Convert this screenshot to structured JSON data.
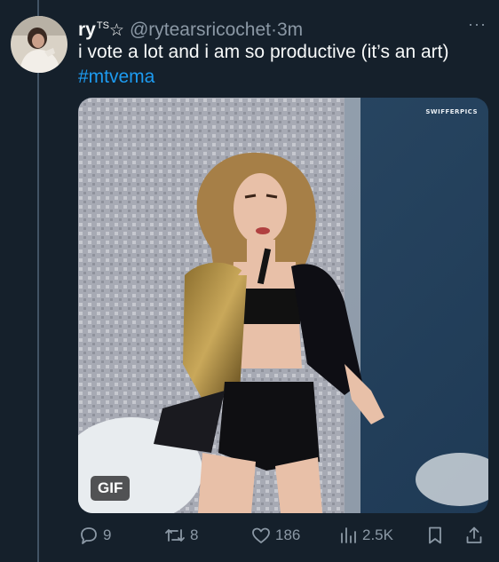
{
  "tweet": {
    "display_name": "ry",
    "name_badge": "TS",
    "name_star": "☆",
    "handle": "@rytearsricochet",
    "separator": "·",
    "time": "3m",
    "text": "i vote a lot and i am so productive (it’s an art)",
    "hashtag": "#mtvema"
  },
  "media": {
    "badge": "GIF",
    "watermark": "SWIFFERPICS"
  },
  "actions": {
    "replies": "9",
    "reposts": "8",
    "likes": "186",
    "views": "2.5K"
  },
  "icons": {
    "more": "more-icon",
    "reply": "reply-icon",
    "repost": "repost-icon",
    "like": "heart-icon",
    "views": "views-icon",
    "bookmark": "bookmark-icon",
    "share": "share-icon"
  },
  "colors": {
    "background": "#15202b",
    "secondary_text": "#8b98a5",
    "link": "#1d9bf0"
  }
}
